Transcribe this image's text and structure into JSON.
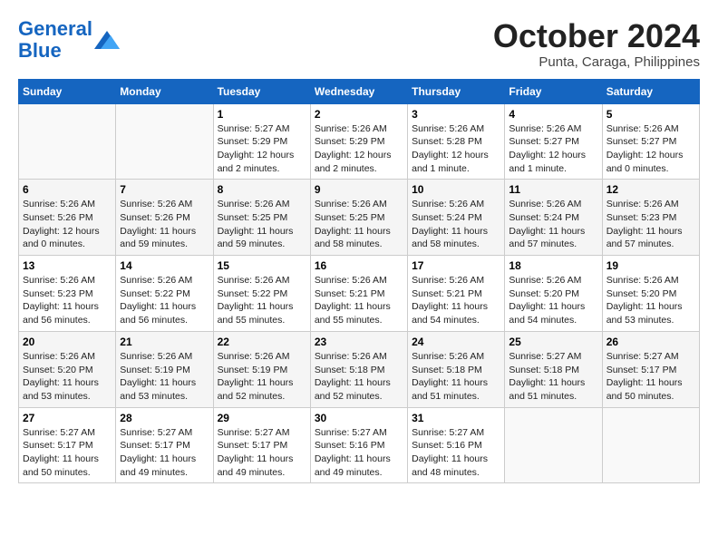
{
  "logo": {
    "line1": "General",
    "line2": "Blue"
  },
  "title": "October 2024",
  "location": "Punta, Caraga, Philippines",
  "headers": [
    "Sunday",
    "Monday",
    "Tuesday",
    "Wednesday",
    "Thursday",
    "Friday",
    "Saturday"
  ],
  "weeks": [
    [
      {
        "day": "",
        "info": ""
      },
      {
        "day": "",
        "info": ""
      },
      {
        "day": "1",
        "info": "Sunrise: 5:27 AM\nSunset: 5:29 PM\nDaylight: 12 hours and 2 minutes."
      },
      {
        "day": "2",
        "info": "Sunrise: 5:26 AM\nSunset: 5:29 PM\nDaylight: 12 hours and 2 minutes."
      },
      {
        "day": "3",
        "info": "Sunrise: 5:26 AM\nSunset: 5:28 PM\nDaylight: 12 hours and 1 minute."
      },
      {
        "day": "4",
        "info": "Sunrise: 5:26 AM\nSunset: 5:27 PM\nDaylight: 12 hours and 1 minute."
      },
      {
        "day": "5",
        "info": "Sunrise: 5:26 AM\nSunset: 5:27 PM\nDaylight: 12 hours and 0 minutes."
      }
    ],
    [
      {
        "day": "6",
        "info": "Sunrise: 5:26 AM\nSunset: 5:26 PM\nDaylight: 12 hours and 0 minutes."
      },
      {
        "day": "7",
        "info": "Sunrise: 5:26 AM\nSunset: 5:26 PM\nDaylight: 11 hours and 59 minutes."
      },
      {
        "day": "8",
        "info": "Sunrise: 5:26 AM\nSunset: 5:25 PM\nDaylight: 11 hours and 59 minutes."
      },
      {
        "day": "9",
        "info": "Sunrise: 5:26 AM\nSunset: 5:25 PM\nDaylight: 11 hours and 58 minutes."
      },
      {
        "day": "10",
        "info": "Sunrise: 5:26 AM\nSunset: 5:24 PM\nDaylight: 11 hours and 58 minutes."
      },
      {
        "day": "11",
        "info": "Sunrise: 5:26 AM\nSunset: 5:24 PM\nDaylight: 11 hours and 57 minutes."
      },
      {
        "day": "12",
        "info": "Sunrise: 5:26 AM\nSunset: 5:23 PM\nDaylight: 11 hours and 57 minutes."
      }
    ],
    [
      {
        "day": "13",
        "info": "Sunrise: 5:26 AM\nSunset: 5:23 PM\nDaylight: 11 hours and 56 minutes."
      },
      {
        "day": "14",
        "info": "Sunrise: 5:26 AM\nSunset: 5:22 PM\nDaylight: 11 hours and 56 minutes."
      },
      {
        "day": "15",
        "info": "Sunrise: 5:26 AM\nSunset: 5:22 PM\nDaylight: 11 hours and 55 minutes."
      },
      {
        "day": "16",
        "info": "Sunrise: 5:26 AM\nSunset: 5:21 PM\nDaylight: 11 hours and 55 minutes."
      },
      {
        "day": "17",
        "info": "Sunrise: 5:26 AM\nSunset: 5:21 PM\nDaylight: 11 hours and 54 minutes."
      },
      {
        "day": "18",
        "info": "Sunrise: 5:26 AM\nSunset: 5:20 PM\nDaylight: 11 hours and 54 minutes."
      },
      {
        "day": "19",
        "info": "Sunrise: 5:26 AM\nSunset: 5:20 PM\nDaylight: 11 hours and 53 minutes."
      }
    ],
    [
      {
        "day": "20",
        "info": "Sunrise: 5:26 AM\nSunset: 5:20 PM\nDaylight: 11 hours and 53 minutes."
      },
      {
        "day": "21",
        "info": "Sunrise: 5:26 AM\nSunset: 5:19 PM\nDaylight: 11 hours and 53 minutes."
      },
      {
        "day": "22",
        "info": "Sunrise: 5:26 AM\nSunset: 5:19 PM\nDaylight: 11 hours and 52 minutes."
      },
      {
        "day": "23",
        "info": "Sunrise: 5:26 AM\nSunset: 5:18 PM\nDaylight: 11 hours and 52 minutes."
      },
      {
        "day": "24",
        "info": "Sunrise: 5:26 AM\nSunset: 5:18 PM\nDaylight: 11 hours and 51 minutes."
      },
      {
        "day": "25",
        "info": "Sunrise: 5:27 AM\nSunset: 5:18 PM\nDaylight: 11 hours and 51 minutes."
      },
      {
        "day": "26",
        "info": "Sunrise: 5:27 AM\nSunset: 5:17 PM\nDaylight: 11 hours and 50 minutes."
      }
    ],
    [
      {
        "day": "27",
        "info": "Sunrise: 5:27 AM\nSunset: 5:17 PM\nDaylight: 11 hours and 50 minutes."
      },
      {
        "day": "28",
        "info": "Sunrise: 5:27 AM\nSunset: 5:17 PM\nDaylight: 11 hours and 49 minutes."
      },
      {
        "day": "29",
        "info": "Sunrise: 5:27 AM\nSunset: 5:17 PM\nDaylight: 11 hours and 49 minutes."
      },
      {
        "day": "30",
        "info": "Sunrise: 5:27 AM\nSunset: 5:16 PM\nDaylight: 11 hours and 49 minutes."
      },
      {
        "day": "31",
        "info": "Sunrise: 5:27 AM\nSunset: 5:16 PM\nDaylight: 11 hours and 48 minutes."
      },
      {
        "day": "",
        "info": ""
      },
      {
        "day": "",
        "info": ""
      }
    ]
  ]
}
